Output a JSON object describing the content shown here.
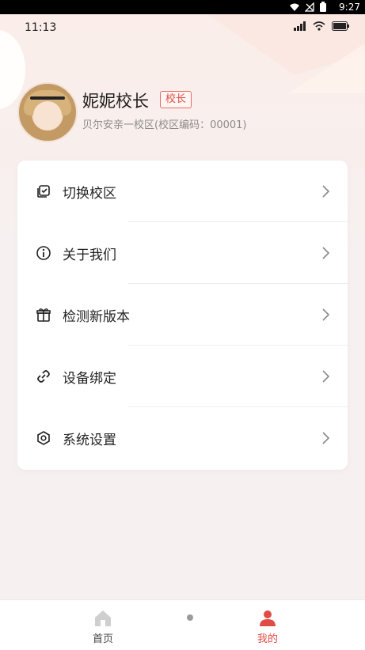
{
  "system_bar": {
    "time": "9:27"
  },
  "status": {
    "time": "11:13"
  },
  "profile": {
    "name": "妮妮校长",
    "role_badge": "校长",
    "campus": "贝尔安亲一校区(校区编码：00001)"
  },
  "menu": {
    "items": [
      {
        "label": "切换校区",
        "icon": "switch-campus-icon"
      },
      {
        "label": "关于我们",
        "icon": "info-icon"
      },
      {
        "label": "检测新版本",
        "icon": "gift-icon"
      },
      {
        "label": "设备绑定",
        "icon": "link-icon"
      },
      {
        "label": "系统设置",
        "icon": "settings-icon"
      }
    ]
  },
  "bottom_nav": {
    "home_label": "首页",
    "mine_label": "我的",
    "active": "mine"
  },
  "colors": {
    "accent": "#e14b45",
    "card": "#ffffff",
    "bg": "#f6f1f0"
  }
}
